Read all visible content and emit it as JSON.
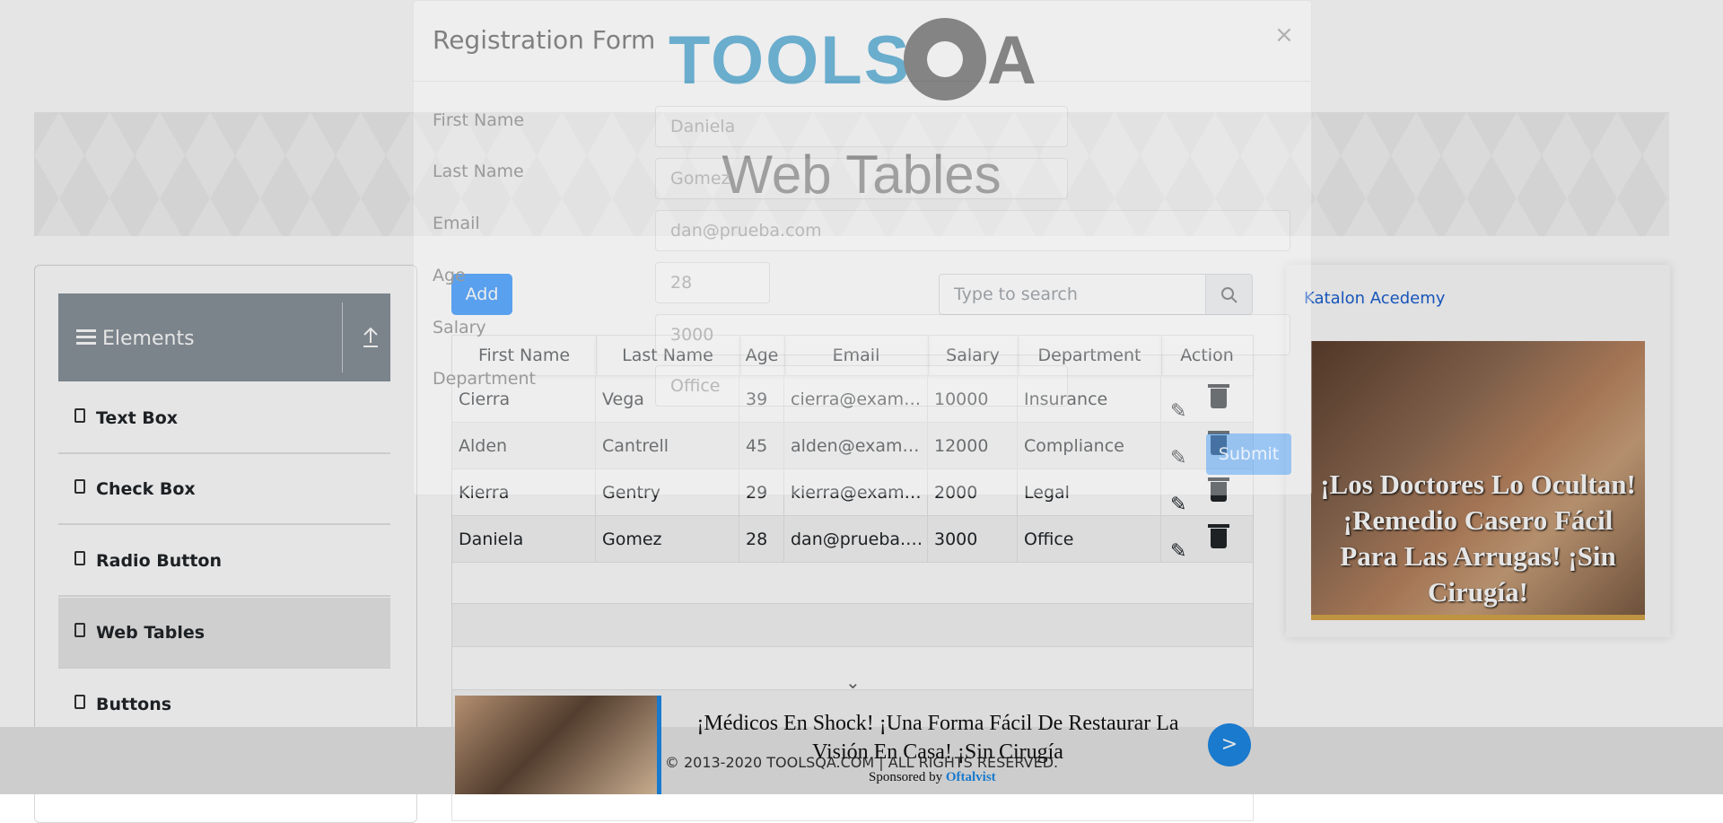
{
  "header": {
    "logo_text_main": "TOOLS",
    "logo_text_q": "Q",
    "logo_text_a": "A"
  },
  "page": {
    "title": "Web Tables"
  },
  "sidebar": {
    "group": {
      "title": "Elements"
    },
    "items": [
      {
        "label": "Text Box"
      },
      {
        "label": "Check Box"
      },
      {
        "label": "Radio Button"
      },
      {
        "label": "Web Tables",
        "active": true
      },
      {
        "label": "Buttons"
      }
    ]
  },
  "toolbar": {
    "add_label": "Add",
    "search_placeholder": "Type to search"
  },
  "table": {
    "columns": [
      "First Name",
      "Last Name",
      "Age",
      "Email",
      "Salary",
      "Department",
      "Action"
    ],
    "rows": [
      [
        "Cierra",
        "Vega",
        "39",
        "cierra@exampl...",
        "10000",
        "Insurance"
      ],
      [
        "Alden",
        "Cantrell",
        "45",
        "alden@exampl...",
        "12000",
        "Compliance"
      ],
      [
        "Kierra",
        "Gentry",
        "29",
        "kierra@examp...",
        "2000",
        "Legal"
      ],
      [
        "Daniela",
        "Gomez",
        "28",
        "dan@prueba.c...",
        "3000",
        "Office"
      ]
    ]
  },
  "modal": {
    "title": "Registration Form",
    "close": "×",
    "fields": [
      {
        "label": "First Name",
        "value": "Daniela"
      },
      {
        "label": "Last Name",
        "value": "Gomez"
      },
      {
        "label": "Email",
        "value": "dan@prueba.com"
      },
      {
        "label": "Age",
        "value": "28"
      },
      {
        "label": "Salary",
        "value": "3000"
      },
      {
        "label": "Department",
        "value": "Office"
      }
    ],
    "submit": "Submit"
  },
  "right_ad": {
    "link_text": "Katalon Acedemy",
    "image_text": "¡Los Doctores Lo Ocultan! ¡Remedio Casero Fácil Para Las Arrugas! ¡Sin Cirugía!"
  },
  "bottom_ad": {
    "headline": "¡Médicos En Shock! ¡Una Forma Fácil De Restaurar La Visión En Casa! ¡Sin Cirugía",
    "go": ">",
    "sponsored_prefix": "Sponsored by",
    "sponsor": "Oftalvist"
  },
  "footer": {
    "copyright": "© 2013-2020 TOOLSQA.COM | ALL RIGHTS RESERVED."
  },
  "colors": {
    "accent": "#007bff",
    "sidebar_header": "#8a929b",
    "title_text": "#5e5e5e"
  },
  "icons": [
    "hamburger-icon",
    "arrow-up-icon",
    "html5-icon",
    "search-icon",
    "pencil-icon",
    "trash-icon",
    "close-icon",
    "chevron-down-icon"
  ]
}
